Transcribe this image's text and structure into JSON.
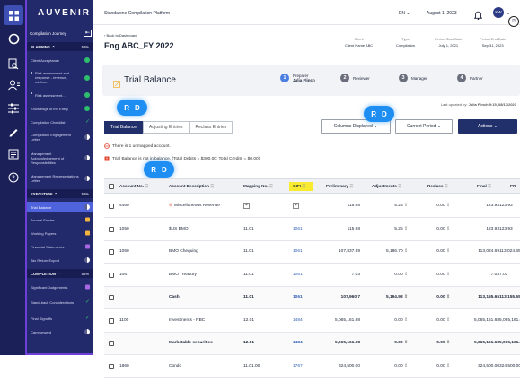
{
  "brand": "AUVENIR",
  "topbar": {
    "platform": "Standalone Compilation Platform",
    "language": "EN",
    "date": "August 1, 2023",
    "avatar": "KW"
  },
  "engagement": {
    "back_label": "Back to Dashboard",
    "title": "Eng ABC_FY 2022",
    "meta": [
      {
        "key": "Client",
        "value": "Client Name ABC"
      },
      {
        "key": "Type",
        "value": "Compilation"
      },
      {
        "key": "Period Start Date",
        "value": "July 1, 2021"
      },
      {
        "key": "Period End Date",
        "value": "Sep 31, 2023"
      }
    ]
  },
  "sidebar": {
    "journey_label": "Compilation Journey",
    "sections": [
      {
        "label": "PLANNING",
        "pct": "58%"
      },
      {
        "label": "EXECUTION",
        "pct": "58%"
      },
      {
        "label": "COMPLETION",
        "pct": "58%"
      }
    ],
    "items": [
      {
        "label": "Client Acceptance",
        "status": "done"
      },
      {
        "label": "Risk assessment and response - revenue, misfea...",
        "status": "done"
      },
      {
        "label": "Risk assessment...",
        "status": "done"
      },
      {
        "label": "Knowledge of the Entity",
        "status": "done"
      },
      {
        "label": "Compilation Checklist",
        "status": "check"
      },
      {
        "label": "Compilation Engagement Letter",
        "status": "half"
      },
      {
        "label": "Management Acknowledgement of Responsibilities",
        "status": "half"
      },
      {
        "label": "Management Representations Letter",
        "status": "half"
      },
      {
        "label": "Trial Balance",
        "status": "half"
      },
      {
        "label": "Journal Entries",
        "status": "edit"
      },
      {
        "label": "Working Papers",
        "status": "edit"
      },
      {
        "label": "Financial Statements",
        "status": "edit2"
      },
      {
        "label": "Tax Return Export",
        "status": "half"
      },
      {
        "label": "Significant Judgements",
        "status": "edit2"
      },
      {
        "label": "Stand-back Considerations",
        "status": "check"
      },
      {
        "label": "Final Signoffs",
        "status": "check"
      },
      {
        "label": "Carryforward",
        "status": "half"
      }
    ]
  },
  "page": {
    "title": "Trial Balance",
    "workflow": [
      {
        "num": "1",
        "label_top": "Preparer",
        "label_bottom": "Julia Flinch",
        "color": "#4c7fe0"
      },
      {
        "num": "2",
        "label_top": "Reviewer",
        "label_bottom": "",
        "color": "#6b6f7d"
      },
      {
        "num": "3",
        "label_top": "Manager",
        "label_bottom": "",
        "color": "#6b6f7d"
      },
      {
        "num": "4",
        "label_top": "Partner",
        "label_bottom": "",
        "color": "#6b6f7d"
      }
    ],
    "updated_prefix": "Last updated by:",
    "updated_by": "Julia Flinch 9:15, 08/17/2023"
  },
  "tabs": [
    "Trial Balance",
    "Adjusting Entries",
    "Reclass Entries"
  ],
  "buttons": {
    "columns": "Columns Displayed",
    "period": "Current Period",
    "actions": "Actions"
  },
  "badges": [
    "R",
    "D"
  ],
  "notices": {
    "unmapped": "There is 1 unmapped account.",
    "unbalanced": "Trial Balance is not in balance. (Total Debits = $300.00; Total Credits = $0.00)"
  },
  "table": {
    "headers": [
      "Account No.",
      "Account Description",
      "Mapping No.",
      "GIFI",
      "Preliminary",
      "Adjustments",
      "Reclass",
      "Final",
      "PR"
    ],
    "rows": [
      {
        "acct": "4460",
        "desc": "Miscellaneous Revenue",
        "map": "",
        "gifi": "",
        "prelim": "115.68",
        "adj": "5.25",
        "reclass": "0.00",
        "final": "123.93",
        "bold": false,
        "warn": true
      },
      {
        "acct": "1050",
        "desc": "$US BMO",
        "map": "11.01",
        "gifi": "1061",
        "prelim": "115.68",
        "adj": "5.25",
        "reclass": "0.00",
        "final": "123.93",
        "bold": false,
        "warn": false
      },
      {
        "acct": "1060",
        "desc": "BMO Chequing",
        "map": "11.01",
        "gifi": "1061",
        "prelim": "107,837.99",
        "adj": "5,186.70",
        "reclass": "0.00",
        "final": "113,024.69",
        "bold": false,
        "warn": false
      },
      {
        "acct": "1067",
        "desc": "BMO Treasury",
        "map": "11.01",
        "gifi": "1061",
        "prelim": "7.03",
        "adj": "0.00",
        "reclass": "0.00",
        "final": "7.03",
        "bold": false,
        "warn": false
      },
      {
        "acct": "",
        "desc": "Cash",
        "map": "11.01",
        "gifi": "1061",
        "prelim": "107,960.7",
        "adj": "5,194.93",
        "reclass": "0.00",
        "final": "113,155.65",
        "bold": true,
        "warn": false
      },
      {
        "acct": "1100",
        "desc": "Investments - RBC",
        "map": "12.01",
        "gifi": "1484",
        "prelim": "5,065,161.68",
        "adj": "0.00",
        "reclass": "0.00",
        "final": "5,065,161.68",
        "bold": false,
        "warn": false
      },
      {
        "acct": "",
        "desc": "Marketable securities",
        "map": "12.01",
        "gifi": "1484",
        "prelim": "5,065,161.68",
        "adj": "0.00",
        "reclass": "0.00",
        "final": "5,065,161.68",
        "bold": true,
        "warn": false
      },
      {
        "acct": "1860",
        "desc": "Condo",
        "map": "11.01.00",
        "gifi": "1767",
        "prelim": "324,500.00",
        "adj": "0.00",
        "reclass": "0.00",
        "final": "324,500.00",
        "bold": false,
        "warn": false
      }
    ]
  },
  "colors": {
    "rail": "#1b2158",
    "sidebar": "#232a6b",
    "active": "#4f63dc",
    "primary": "#21306b",
    "badge": "#1f8ef2",
    "gifi_highlight": "#f7ea2f",
    "warning": "#e0452f"
  }
}
